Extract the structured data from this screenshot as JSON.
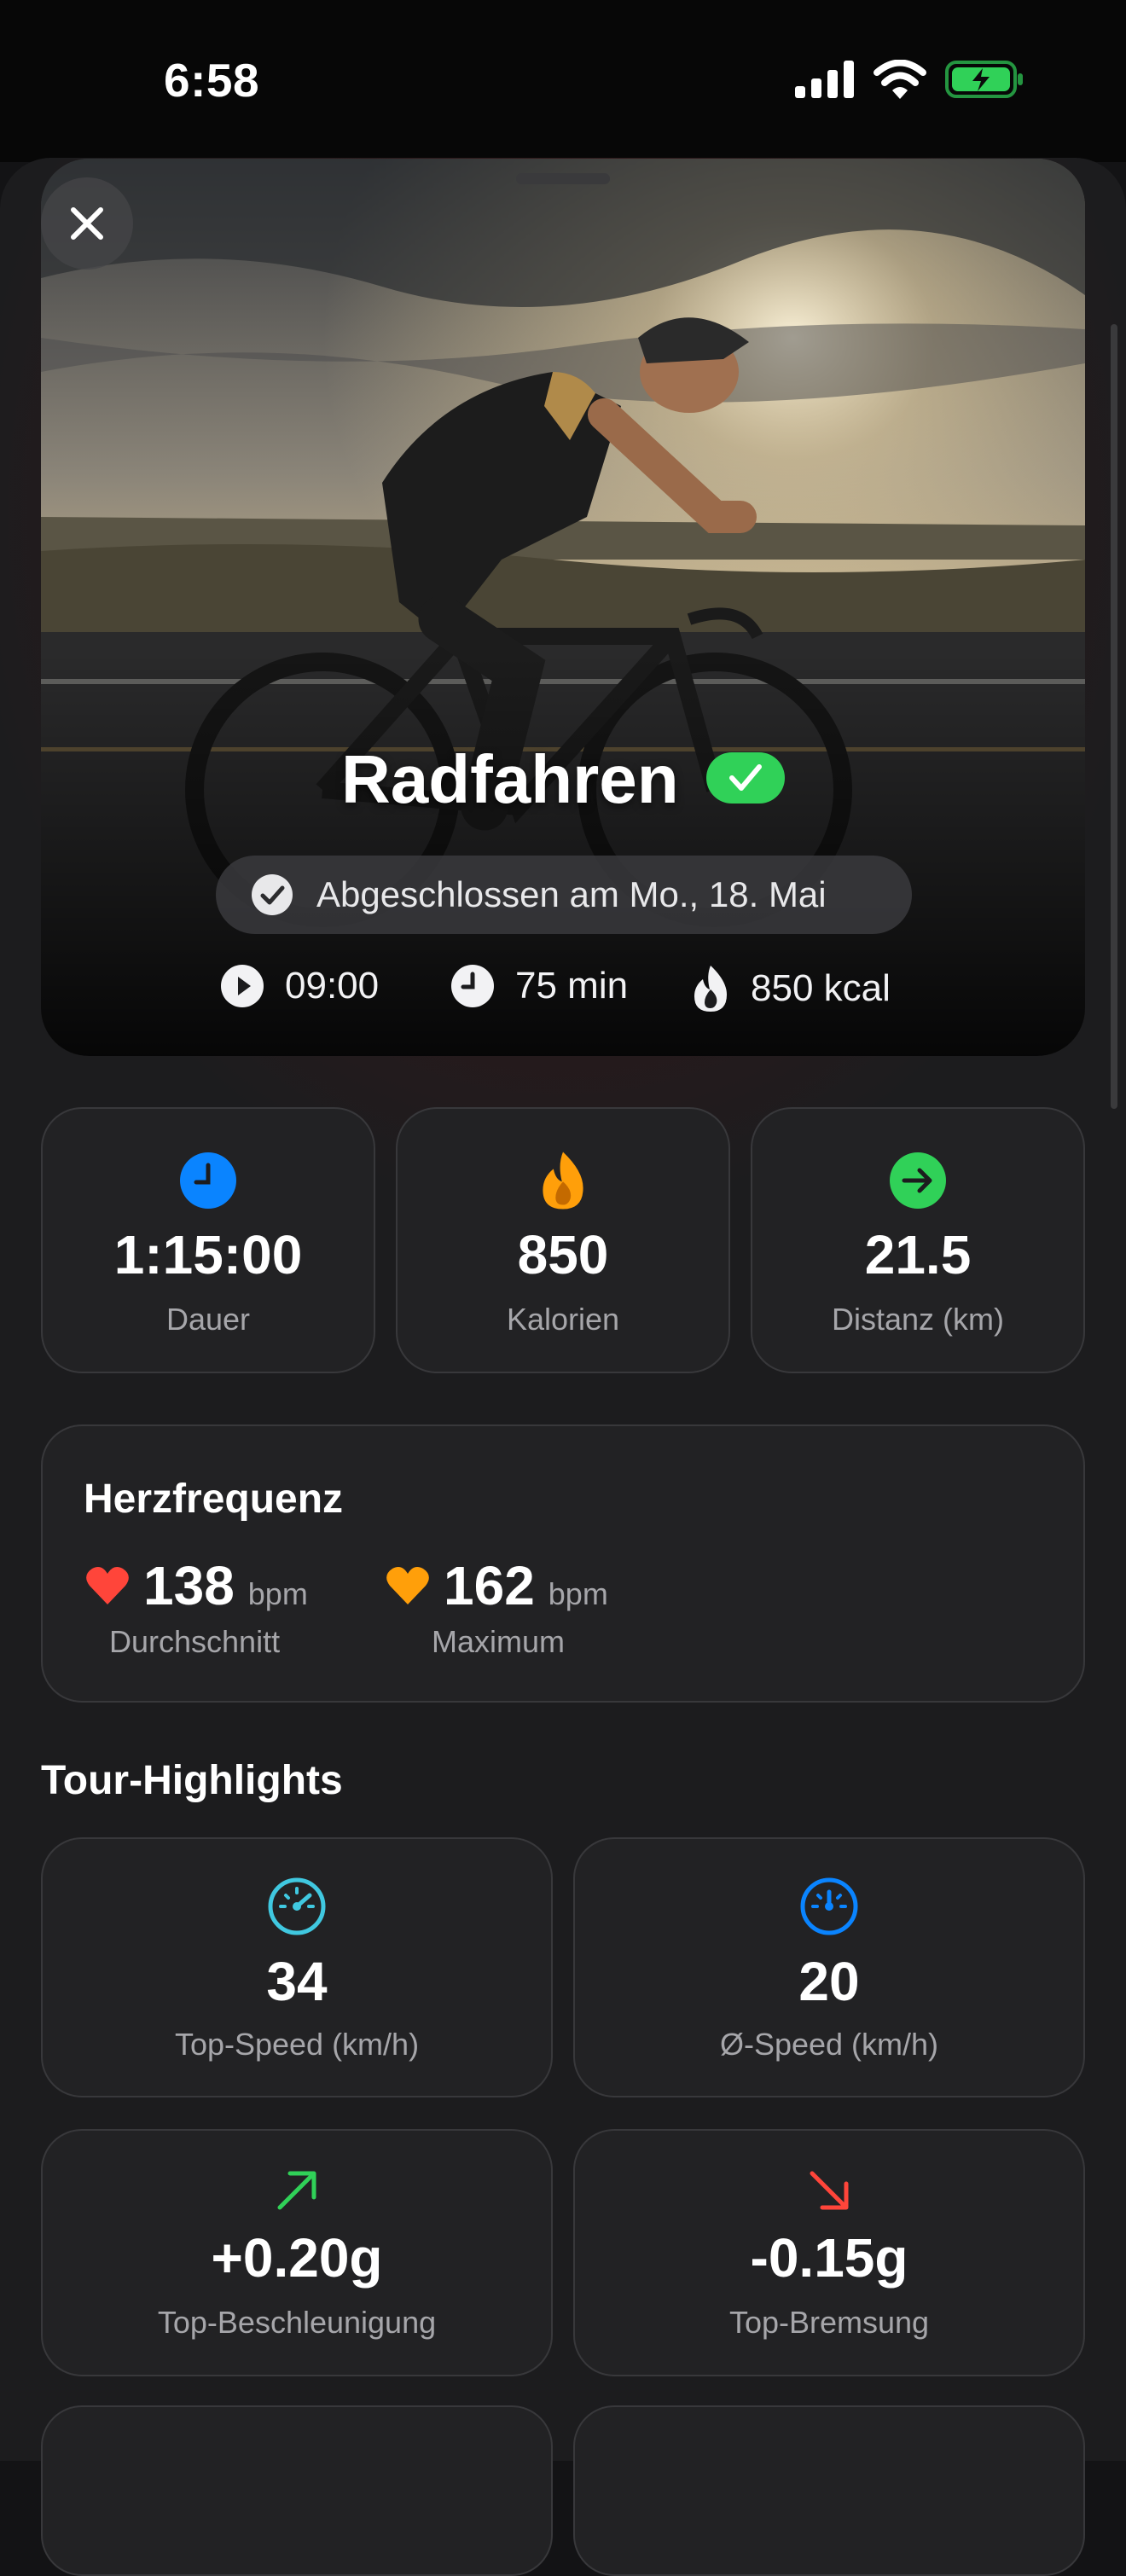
{
  "status_bar": {
    "time": "6:58"
  },
  "workout": {
    "title": "Radfahren",
    "completed_text": "Abgeschlossen am Mo., 18. Mai",
    "start_time": "09:00",
    "duration_short": "75 min",
    "calories_short": "850 kcal"
  },
  "stats": [
    {
      "value": "1:15:00",
      "label": "Dauer",
      "icon": "clock-icon",
      "color": "#0a84ff"
    },
    {
      "value": "850",
      "label": "Kalorien",
      "icon": "flame-icon",
      "color": "#ff9f0a"
    },
    {
      "value": "21.5",
      "label": "Distanz (km)",
      "icon": "arrow-right-circle-icon",
      "color": "#30d158"
    }
  ],
  "heart_rate": {
    "title": "Herzfrequenz",
    "average": {
      "value": "138",
      "unit": "bpm",
      "label": "Durchschnitt",
      "color": "#ff453a"
    },
    "maximum": {
      "value": "162",
      "unit": "bpm",
      "label": "Maximum",
      "color": "#ff9f0a"
    }
  },
  "highlights": {
    "title": "Tour-Highlights",
    "items": [
      {
        "value": "34",
        "label": "Top-Speed (km/h)",
        "icon": "speedometer-icon",
        "color": "#40c8e0"
      },
      {
        "value": "20",
        "label": "Ø-Speed (km/h)",
        "icon": "gauge-icon",
        "color": "#0a84ff"
      },
      {
        "value": "+0.20g",
        "label": "Top-Beschleunigung",
        "icon": "arrow-up-right-icon",
        "color": "#30d158"
      },
      {
        "value": "-0.15g",
        "label": "Top-Bremsung",
        "icon": "arrow-down-right-icon",
        "color": "#ff453a"
      }
    ]
  }
}
